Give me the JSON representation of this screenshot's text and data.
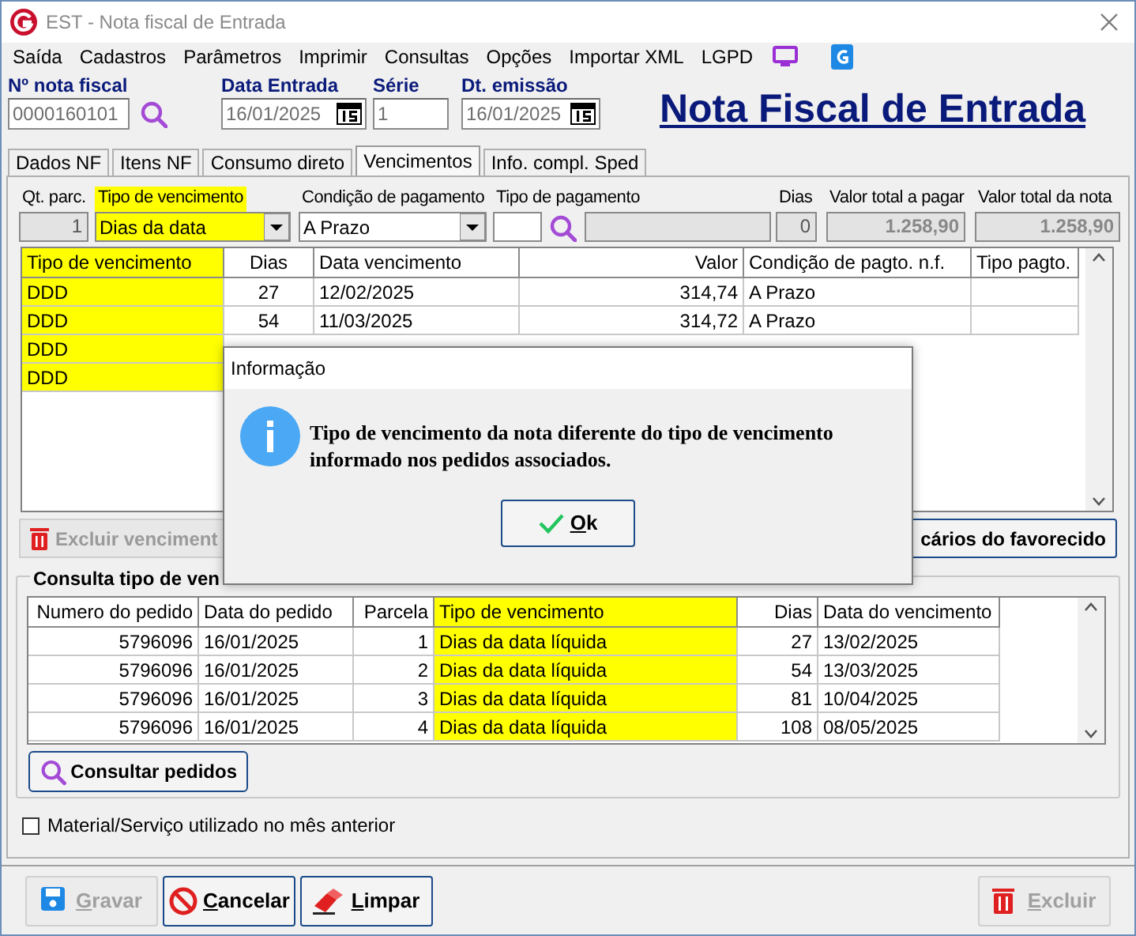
{
  "window": {
    "title": "EST - Nota fiscal de Entrada"
  },
  "menu": [
    "Saída",
    "Cadastros",
    "Parâmetros",
    "Imprimir",
    "Consultas",
    "Opções",
    "Importar XML",
    "LGPD"
  ],
  "header": {
    "fields": [
      {
        "label": "Nº nota fiscal",
        "value": "0000160101",
        "kind": "search"
      },
      {
        "label": "Data Entrada",
        "value": "16/01/2025",
        "kind": "date"
      },
      {
        "label": "Série",
        "value": "1",
        "kind": "plain"
      },
      {
        "label": "Dt. emissão",
        "value": "16/01/2025",
        "kind": "date"
      }
    ],
    "title": "Nota Fiscal de Entrada"
  },
  "tabs": [
    {
      "label": "Dados NF",
      "selected": false
    },
    {
      "label": "Itens NF",
      "selected": false
    },
    {
      "label": "Consumo direto",
      "selected": false
    },
    {
      "label": "Vencimentos",
      "selected": true
    },
    {
      "label": "Info. compl. Sped",
      "selected": false
    }
  ],
  "summary": [
    {
      "label": "Qt. parc.",
      "value": "1",
      "kind": "readonly",
      "highlight": false
    },
    {
      "label": "Tipo de vencimento",
      "value": "Dias da data",
      "kind": "combo",
      "highlight": true
    },
    {
      "label": "Condição de pagamento",
      "value": "A Prazo",
      "kind": "combo",
      "highlight": false
    },
    {
      "label": "Tipo de pagamento",
      "kind": "lookup",
      "highlight": false
    },
    {
      "label": "Dias",
      "value": "0",
      "kind": "readonly",
      "highlight": false
    },
    {
      "label": "Valor total a pagar",
      "value": "1.258,90",
      "kind": "readonly",
      "highlight": false
    },
    {
      "label": "Valor total da nota",
      "value": "1.258,90",
      "kind": "readonly",
      "highlight": false
    }
  ],
  "installments": {
    "columns": [
      {
        "label": "Tipo de vencimento",
        "highlight": true
      },
      {
        "label": "Dias",
        "highlight": false
      },
      {
        "label": "Data vencimento",
        "highlight": false
      },
      {
        "label": "Valor",
        "highlight": false
      },
      {
        "label": "Condição de pagto. n.f.",
        "highlight": false
      },
      {
        "label": "Tipo pagto.",
        "highlight": false
      }
    ],
    "rows": [
      {
        "cells": [
          "DDD",
          "27",
          "12/02/2025",
          "314,74",
          "A Prazo",
          ""
        ]
      },
      {
        "cells": [
          "DDD",
          "54",
          "11/03/2025",
          "314,72",
          "A Prazo",
          ""
        ]
      },
      {
        "cells": [
          "DDD"
        ]
      },
      {
        "cells": [
          "DDD"
        ]
      }
    ]
  },
  "grid_buttons": [
    {
      "label": "Excluir venciment",
      "kind": "delete",
      "disabled": true
    },
    {
      "label": "cários do favorecido",
      "kind": "plain",
      "disabled": false
    }
  ],
  "orders": {
    "title": "Consulta tipo de ven",
    "columns": [
      {
        "label": "Numero do pedido",
        "highlight": false
      },
      {
        "label": "Data do pedido",
        "highlight": false
      },
      {
        "label": "Parcela",
        "highlight": false
      },
      {
        "label": "Tipo de vencimento",
        "highlight": true
      },
      {
        "label": "Dias",
        "highlight": false
      },
      {
        "label": "Data do vencimento",
        "highlight": false
      }
    ],
    "rows": [
      {
        "cells": [
          "5796096",
          "16/01/2025",
          "1",
          "Dias da data líquida",
          "27",
          "13/02/2025"
        ]
      },
      {
        "cells": [
          "5796096",
          "16/01/2025",
          "2",
          "Dias da data líquida",
          "54",
          "13/03/2025"
        ]
      },
      {
        "cells": [
          "5796096",
          "16/01/2025",
          "3",
          "Dias da data líquida",
          "81",
          "10/04/2025"
        ]
      },
      {
        "cells": [
          "5796096",
          "16/01/2025",
          "4",
          "Dias da data líquida",
          "108",
          "08/05/2025"
        ]
      }
    ],
    "button": "Consultar pedidos"
  },
  "checkbox": {
    "label": "Material/Serviço utilizado no mês anterior",
    "checked": false
  },
  "footer_buttons": [
    {
      "label": "Gravar",
      "kind": "save",
      "disabled": true
    },
    {
      "label": "Cancelar",
      "kind": "cancel",
      "disabled": false
    },
    {
      "label": "Limpar",
      "kind": "clear",
      "disabled": false
    },
    {
      "label": "Excluir",
      "kind": "delete",
      "disabled": true
    }
  ],
  "dialog": {
    "title": "Informação",
    "message": "Tipo de vencimento da nota diferente do tipo de vencimento informado nos pedidos associados.",
    "button": "Ok"
  }
}
